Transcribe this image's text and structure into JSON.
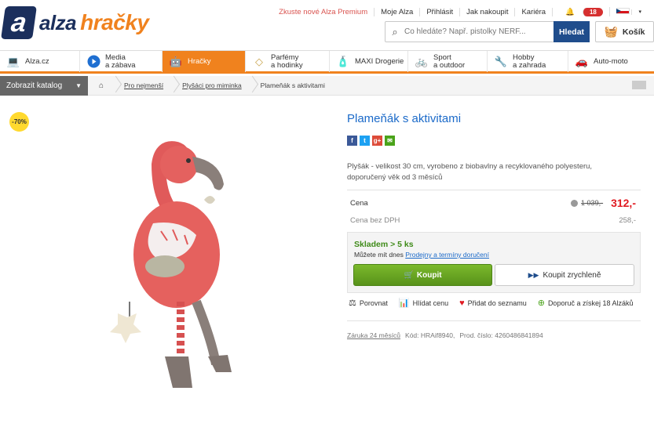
{
  "logo": {
    "mark": "a",
    "alza": "alza",
    "hracky": "hračky"
  },
  "toplinks": [
    "Zkuste nové Alza Premium",
    "Moje Alza",
    "Přihlásit",
    "Jak nakoupit",
    "Kariéra"
  ],
  "notif_count": "18",
  "search": {
    "placeholder": "Co hledáte? Např. pistolky NERF...",
    "button": "Hledat"
  },
  "cart": {
    "label": "Košík"
  },
  "nav": [
    {
      "line1": "Alza.cz",
      "line2": "",
      "icon": "laptop-icon"
    },
    {
      "line1": "Media",
      "line2": "a zábava",
      "icon": "play-icon"
    },
    {
      "line1": "Hračky",
      "line2": "",
      "icon": "toy-icon"
    },
    {
      "line1": "Parfémy",
      "line2": "a hodinky",
      "icon": "diamond-icon"
    },
    {
      "line1": "MAXI Drogerie",
      "line2": "",
      "icon": "bottle-icon"
    },
    {
      "line1": "Sport",
      "line2": "a outdoor",
      "icon": "bike-icon"
    },
    {
      "line1": "Hobby",
      "line2": "a zahrada",
      "icon": "drill-icon"
    },
    {
      "line1": "Auto-moto",
      "line2": "",
      "icon": "car-icon"
    }
  ],
  "catalog": "Zobrazit katalog",
  "breadcrumbs": [
    "Pro nejmenší",
    "Plyšáci pro miminka",
    "Plameňák s aktivitami"
  ],
  "discount": "-70%",
  "product": {
    "title": "Plameňák s aktivitami",
    "description": "Plyšák - velikost 30 cm, vyrobeno z biobavlny a recyklovaného polyesteru, doporučený věk od 3 měsíců",
    "price_label": "Cena",
    "old_price": "1 039,-",
    "price": "312,-",
    "price_nodph_label": "Cena bez DPH",
    "price_nodph": "258,-",
    "stock": "Skladem > 5 ks",
    "delivery_prefix": "Můžete mít dnes",
    "delivery_link": "Prodejny a termíny doručení",
    "buy": "Koupit",
    "buy_fast": "Koupit zrychleně",
    "warranty": "Záruka 24 měsíců",
    "code": "Kód: HRAif8940,",
    "prod_no": "Prod. číslo: 4260486841894"
  },
  "actions": [
    "Porovnat",
    "Hlídat cenu",
    "Přidat do seznamu",
    "Doporuč a získej 18 Alzáků"
  ],
  "colors": {
    "orange": "#f0821e",
    "navy": "#1b2f5c",
    "link": "#1b6ac9",
    "green": "#58921a",
    "price_red": "#e01b22"
  }
}
